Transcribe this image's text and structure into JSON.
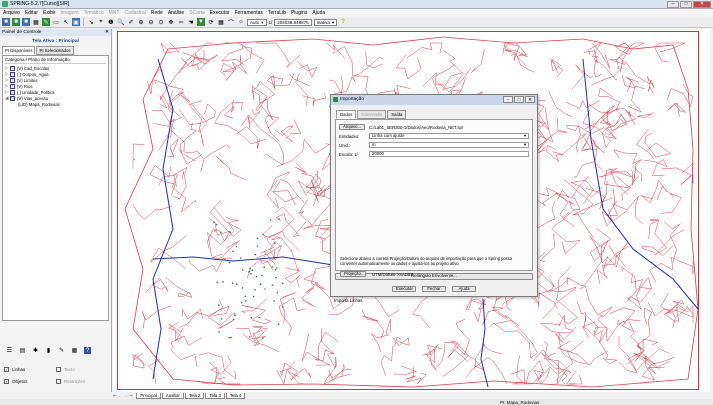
{
  "window": {
    "title": "SPRING-5.2.7[Curso][SIR]",
    "min": "–",
    "max": "□",
    "close": "✕"
  },
  "menu": [
    {
      "label": "Arquivo",
      "enabled": true
    },
    {
      "label": "Editar",
      "enabled": true
    },
    {
      "label": "Exibir",
      "enabled": true
    },
    {
      "label": "Imagem",
      "enabled": false
    },
    {
      "label": "Temático",
      "enabled": false
    },
    {
      "label": "MNT",
      "enabled": false
    },
    {
      "label": "Cadastral",
      "enabled": false
    },
    {
      "label": "Rede",
      "enabled": true
    },
    {
      "label": "Análise",
      "enabled": true
    },
    {
      "label": "SCarta",
      "enabled": false
    },
    {
      "label": "Executar",
      "enabled": true
    },
    {
      "label": "Ferramentas",
      "enabled": true
    },
    {
      "label": "TerraLib",
      "enabled": true
    },
    {
      "label": "Plugins",
      "enabled": true
    },
    {
      "label": "Ajuda",
      "enabled": true
    }
  ],
  "toolbar": {
    "zoom_mode": "Auto",
    "scale_prefix": "1/",
    "scale_value": "204038.848875",
    "mode": "Inativa",
    "help": "?"
  },
  "panel": {
    "header": "Painel de Controle",
    "close": "✕",
    "title": "Tela Ativa : Principal",
    "tabs": [
      "PI Disponíveis",
      "PI Selecionados"
    ],
    "tree_header": "Categoria / Plano de Informação",
    "categories": [
      {
        "expander": "▷",
        "letter": "C",
        "label": "(V) Cad_Escolas"
      },
      {
        "expander": "▷",
        "letter": "T",
        "label": "( ) Corpos_Agua"
      },
      {
        "expander": "▷",
        "letter": "T",
        "label": "(V) Limites"
      },
      {
        "expander": "▷",
        "letter": "T",
        "label": "(V) Rios"
      },
      {
        "expander": "▷",
        "letter": "C",
        "label": "( ) Unidade_Politica"
      },
      {
        "expander": "◢",
        "letter": "O",
        "label": "(V) Vias_acesso"
      }
    ],
    "sub_items": [
      "(LID) Mapa_Rodovias"
    ],
    "checks": [
      {
        "label": "Linhas",
        "checked": true,
        "enabled": true
      },
      {
        "label": "Texto",
        "checked": false,
        "enabled": false
      },
      {
        "label": "Objetos",
        "checked": true,
        "enabled": true
      },
      {
        "label": "Restrições",
        "checked": false,
        "enabled": false
      }
    ]
  },
  "sheets": {
    "nav": "⇤ ← → ⇥",
    "tabs": [
      "Principal",
      "Auxiliar",
      "Tela 2",
      "Tela 3",
      "Tela 4"
    ]
  },
  "status": {
    "right": "PI: Mapa_Rodovias"
  },
  "dialog": {
    "title": "Importação",
    "tabs": [
      {
        "label": "Dados",
        "enabled": true
      },
      {
        "label": "Conversão",
        "enabled": false
      },
      {
        "label": "Saída",
        "enabled": true
      }
    ],
    "file_button": "Arquivo...",
    "file_path": "C:/Lab1_SER300-1/Dados/Aeo/Rodovia_NET.spr",
    "entity_label": "Entidades:",
    "entity_value": "Linha com ajuste",
    "unit_label": "Unid.:",
    "unit_value": "m",
    "scale_label": "Escala: 1/",
    "scale_value": "20000",
    "info_text": "Selecione abaixo a correta Projeção/Datum do arquivo de importação para que o Spring possa converter automaticamente os dados e ajustá-los ao projeto ativo.",
    "projection_button": "Projeção...",
    "projection_value": "UTM/Datum->SAD69",
    "envelope_button": "Retângulo Envolvente...",
    "execute": "Executar",
    "close_btn": "Fechar",
    "help": "Ajuda",
    "status_text": "Importa Linhas",
    "win_min": "–",
    "win_max": "□",
    "win_close": "✕"
  },
  "colors": {
    "roads": "#e03a4d",
    "limits": "#1a2fb8",
    "dots": "#2f7d3a",
    "frame": "#e03030"
  }
}
